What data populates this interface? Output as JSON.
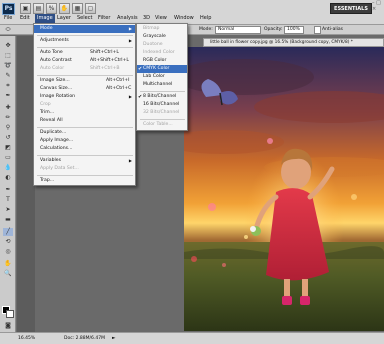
{
  "menubar": {
    "logo": "Ps",
    "items": [
      {
        "label": "File"
      },
      {
        "label": "Edit"
      },
      {
        "label": "Image"
      },
      {
        "label": "Layer"
      },
      {
        "label": "Select"
      },
      {
        "label": "Filter"
      },
      {
        "label": "Analysis"
      },
      {
        "label": "3D"
      },
      {
        "label": "View"
      },
      {
        "label": "Window"
      },
      {
        "label": "Help"
      }
    ],
    "active_item": "Image",
    "workspace_label": "ESSENTIALS",
    "window_controls": "–  □  ×"
  },
  "options_bar": {
    "mode_label": "Mode:",
    "mode_value": "Normal",
    "opacity_label": "Opacity:",
    "opacity_value": "100%",
    "anti_alias_label": "Anti-alias"
  },
  "document": {
    "tab_title": "little ball in flower copy.jpg @ 16.5% (Background copy, CMYK/8) *"
  },
  "statusbar": {
    "zoom": "16.45%",
    "doc_info": "Doc: 2.88M/6.47M"
  },
  "image_menu": {
    "items": [
      {
        "label": "Mode",
        "shortcut": "",
        "submenu": true,
        "highlighted": true
      },
      {
        "label": "Adjustments",
        "shortcut": "",
        "submenu": true
      },
      {
        "label": "Auto Tone",
        "shortcut": "Shift+Ctrl+L"
      },
      {
        "label": "Auto Contrast",
        "shortcut": "Alt+Shift+Ctrl+L"
      },
      {
        "label": "Auto Color",
        "shortcut": "Shift+Ctrl+B",
        "disabled": true
      },
      {
        "label": "Image Size...",
        "shortcut": "Alt+Ctrl+I"
      },
      {
        "label": "Canvas Size...",
        "shortcut": "Alt+Ctrl+C"
      },
      {
        "label": "Image Rotation",
        "shortcut": "",
        "submenu": true
      },
      {
        "label": "Crop",
        "shortcut": "",
        "disabled": true
      },
      {
        "label": "Trim...",
        "shortcut": ""
      },
      {
        "label": "Reveal All",
        "shortcut": ""
      },
      {
        "label": "Duplicate...",
        "shortcut": ""
      },
      {
        "label": "Apply Image...",
        "shortcut": ""
      },
      {
        "label": "Calculations...",
        "shortcut": ""
      },
      {
        "label": "Variables",
        "shortcut": "",
        "submenu": true
      },
      {
        "label": "Apply Data Set...",
        "shortcut": "",
        "disabled": true
      },
      {
        "label": "Trap...",
        "shortcut": ""
      }
    ]
  },
  "mode_submenu": {
    "items": [
      {
        "label": "Bitmap",
        "disabled": true
      },
      {
        "label": "Grayscale"
      },
      {
        "label": "Duotone",
        "disabled": true
      },
      {
        "label": "Indexed Color",
        "disabled": true
      },
      {
        "label": "RGB Color"
      },
      {
        "label": "CMYK Color",
        "checked": true,
        "highlighted": true
      },
      {
        "label": "Lab Color"
      },
      {
        "label": "Multichannel"
      },
      {
        "label": "8 Bits/Channel",
        "checked": true
      },
      {
        "label": "16 Bits/Channel"
      },
      {
        "label": "32 Bits/Channel",
        "disabled": true
      },
      {
        "label": "Color Table...",
        "disabled": true
      }
    ]
  },
  "colors": {
    "menu_highlight": "#3a6fbf",
    "menubar_active": "#2f4f86",
    "workspace_button": "#3c3c3c"
  }
}
